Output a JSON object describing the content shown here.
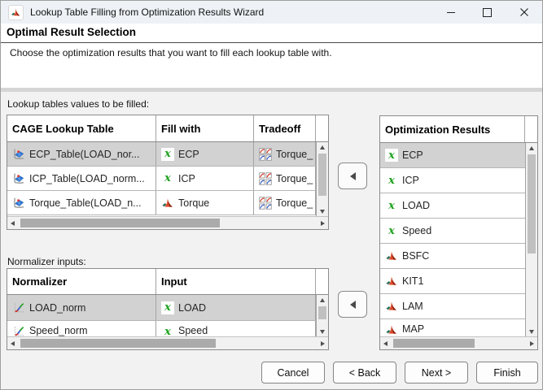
{
  "titlebar": {
    "title": "Lookup Table Filling from Optimization Results Wizard"
  },
  "header": {
    "title": "Optimal Result Selection",
    "description": "Choose the optimization results that you want to fill each lookup table with."
  },
  "icons": {
    "x_variable": "x"
  },
  "lookup_tables": {
    "label": "Lookup tables values to be filled:",
    "columns": {
      "table": "CAGE Lookup Table",
      "fill": "Fill with",
      "tradeoff": "Tradeoff"
    },
    "rows": [
      {
        "table": "ECP_Table(LOAD_nor...",
        "fill": "ECP",
        "tradeoff": "Torque_",
        "selected": true
      },
      {
        "table": "ICP_Table(LOAD_norm...",
        "fill": "ICP",
        "tradeoff": "Torque_",
        "selected": false
      },
      {
        "table": "Torque_Table(LOAD_n...",
        "fill": "Torque",
        "tradeoff": "Torque_",
        "selected": false
      }
    ]
  },
  "normalizers": {
    "label": "Normalizer inputs:",
    "columns": {
      "normalizer": "Normalizer",
      "input": "Input"
    },
    "rows": [
      {
        "normalizer": "LOAD_norm",
        "input": "LOAD",
        "selected": true
      },
      {
        "normalizer": "Speed_norm",
        "input": "Speed",
        "selected": false
      }
    ]
  },
  "optimization_results": {
    "column": "Optimization Results",
    "items": [
      {
        "label": "ECP",
        "icon": "x-variable",
        "selected": true
      },
      {
        "label": "ICP",
        "icon": "x-variable",
        "selected": false
      },
      {
        "label": "LOAD",
        "icon": "x-variable",
        "selected": false
      },
      {
        "label": "Speed",
        "icon": "x-variable",
        "selected": false
      },
      {
        "label": "BSFC",
        "icon": "matlab-model",
        "selected": false
      },
      {
        "label": "KIT1",
        "icon": "matlab-model",
        "selected": false
      },
      {
        "label": "LAM",
        "icon": "matlab-model",
        "selected": false
      },
      {
        "label": "MAP",
        "icon": "matlab-model",
        "selected": false
      }
    ]
  },
  "buttons": {
    "cancel": "Cancel",
    "back": "< Back",
    "next": "Next >",
    "finish": "Finish"
  },
  "colors": {
    "selection": "#d2d2d2",
    "content_bg": "#f2f2f2",
    "variable_green": "#1ea21e",
    "matlab_orange": "#de4b2b"
  }
}
